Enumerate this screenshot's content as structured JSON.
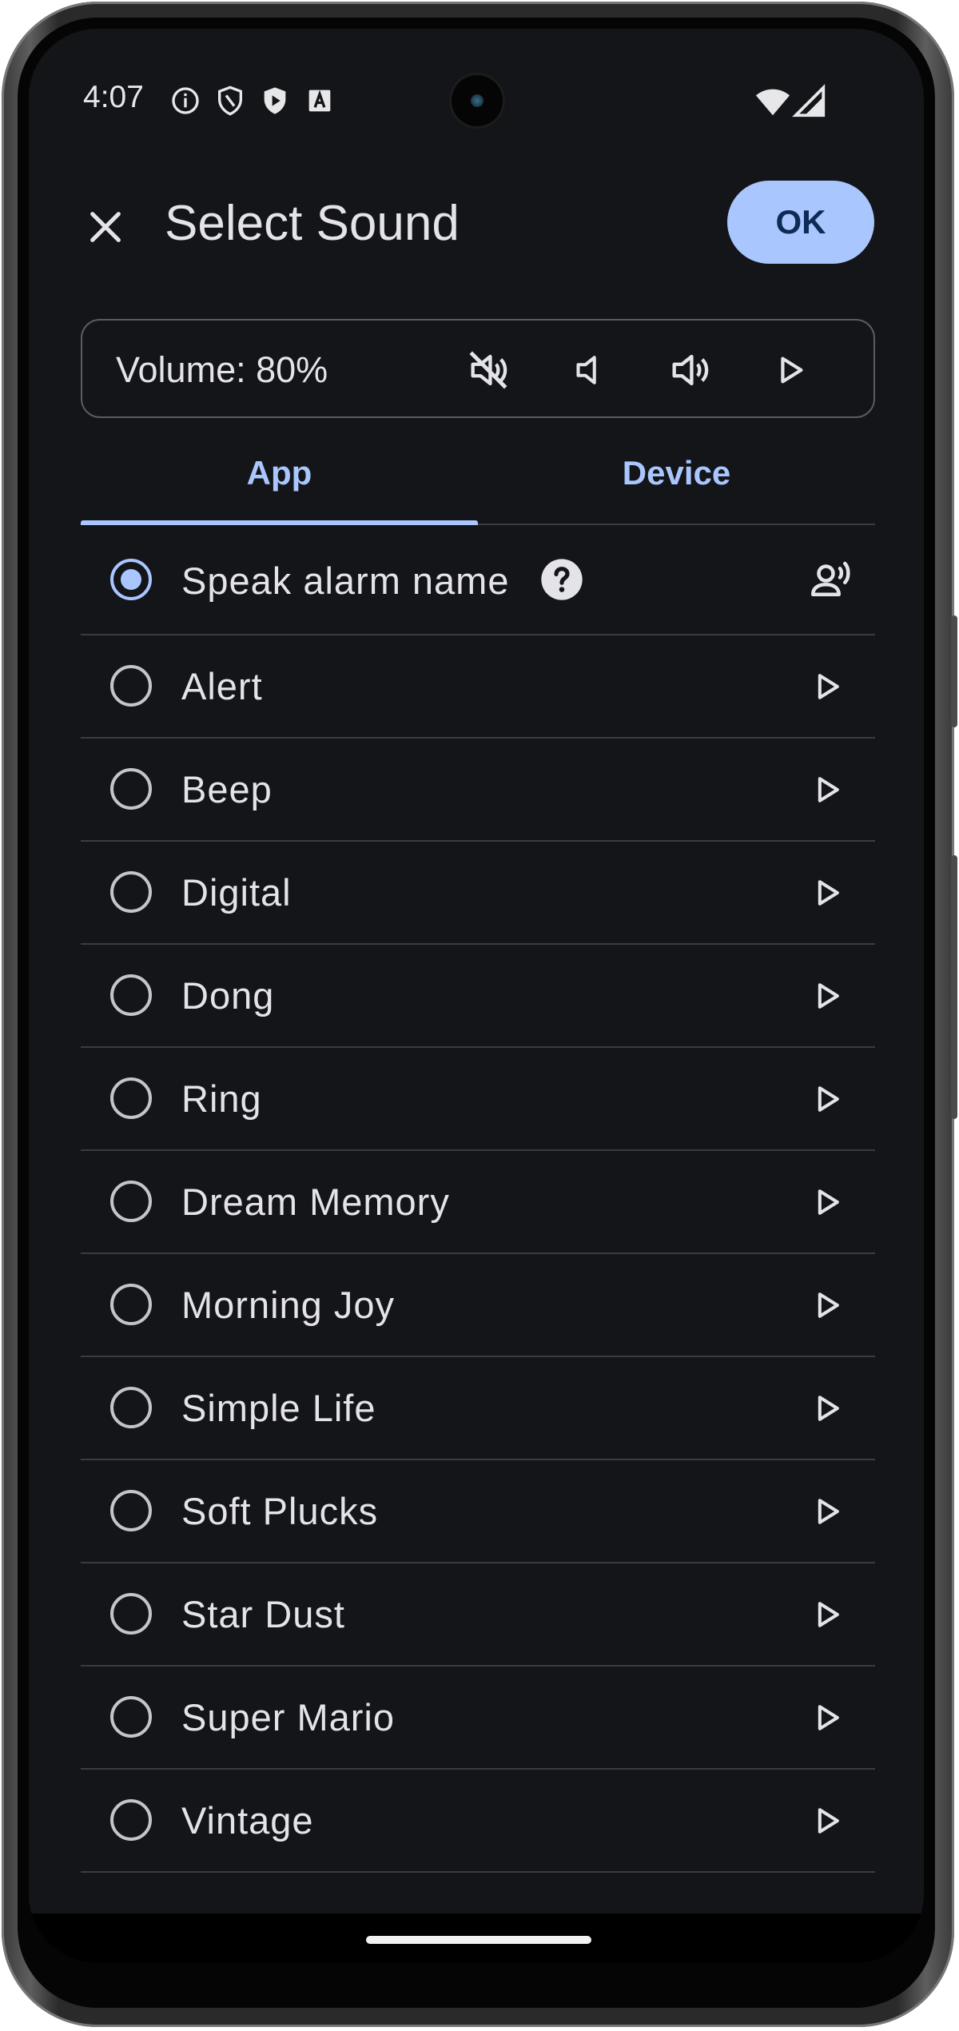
{
  "status_bar": {
    "time": "4:07",
    "icons": [
      "info-icon",
      "shield-icon",
      "play-shield-icon",
      "a11y-text-icon"
    ],
    "right_icons": [
      "wifi-icon",
      "signal-icon"
    ]
  },
  "header": {
    "title": "Select Sound",
    "ok_label": "OK"
  },
  "volume": {
    "label": "Volume: 80%",
    "buttons": [
      "mute-icon",
      "volume-down-icon",
      "volume-up-icon",
      "play-icon"
    ]
  },
  "tabs": [
    {
      "label": "App",
      "selected": true
    },
    {
      "label": "Device",
      "selected": false
    }
  ],
  "sounds": {
    "speak": {
      "label": "Speak alarm name",
      "selected": true
    },
    "items": [
      {
        "label": "Alert"
      },
      {
        "label": "Beep"
      },
      {
        "label": "Digital"
      },
      {
        "label": "Dong"
      },
      {
        "label": "Ring"
      },
      {
        "label": "Dream Memory"
      },
      {
        "label": "Morning Joy"
      },
      {
        "label": "Simple Life"
      },
      {
        "label": "Soft Plucks"
      },
      {
        "label": "Star Dust"
      },
      {
        "label": "Super Mario"
      },
      {
        "label": "Vintage"
      }
    ]
  },
  "colors": {
    "accent": "#a9c6ff",
    "background": "#141518",
    "text": "#e4e4e8",
    "divider": "#3b3c41"
  }
}
